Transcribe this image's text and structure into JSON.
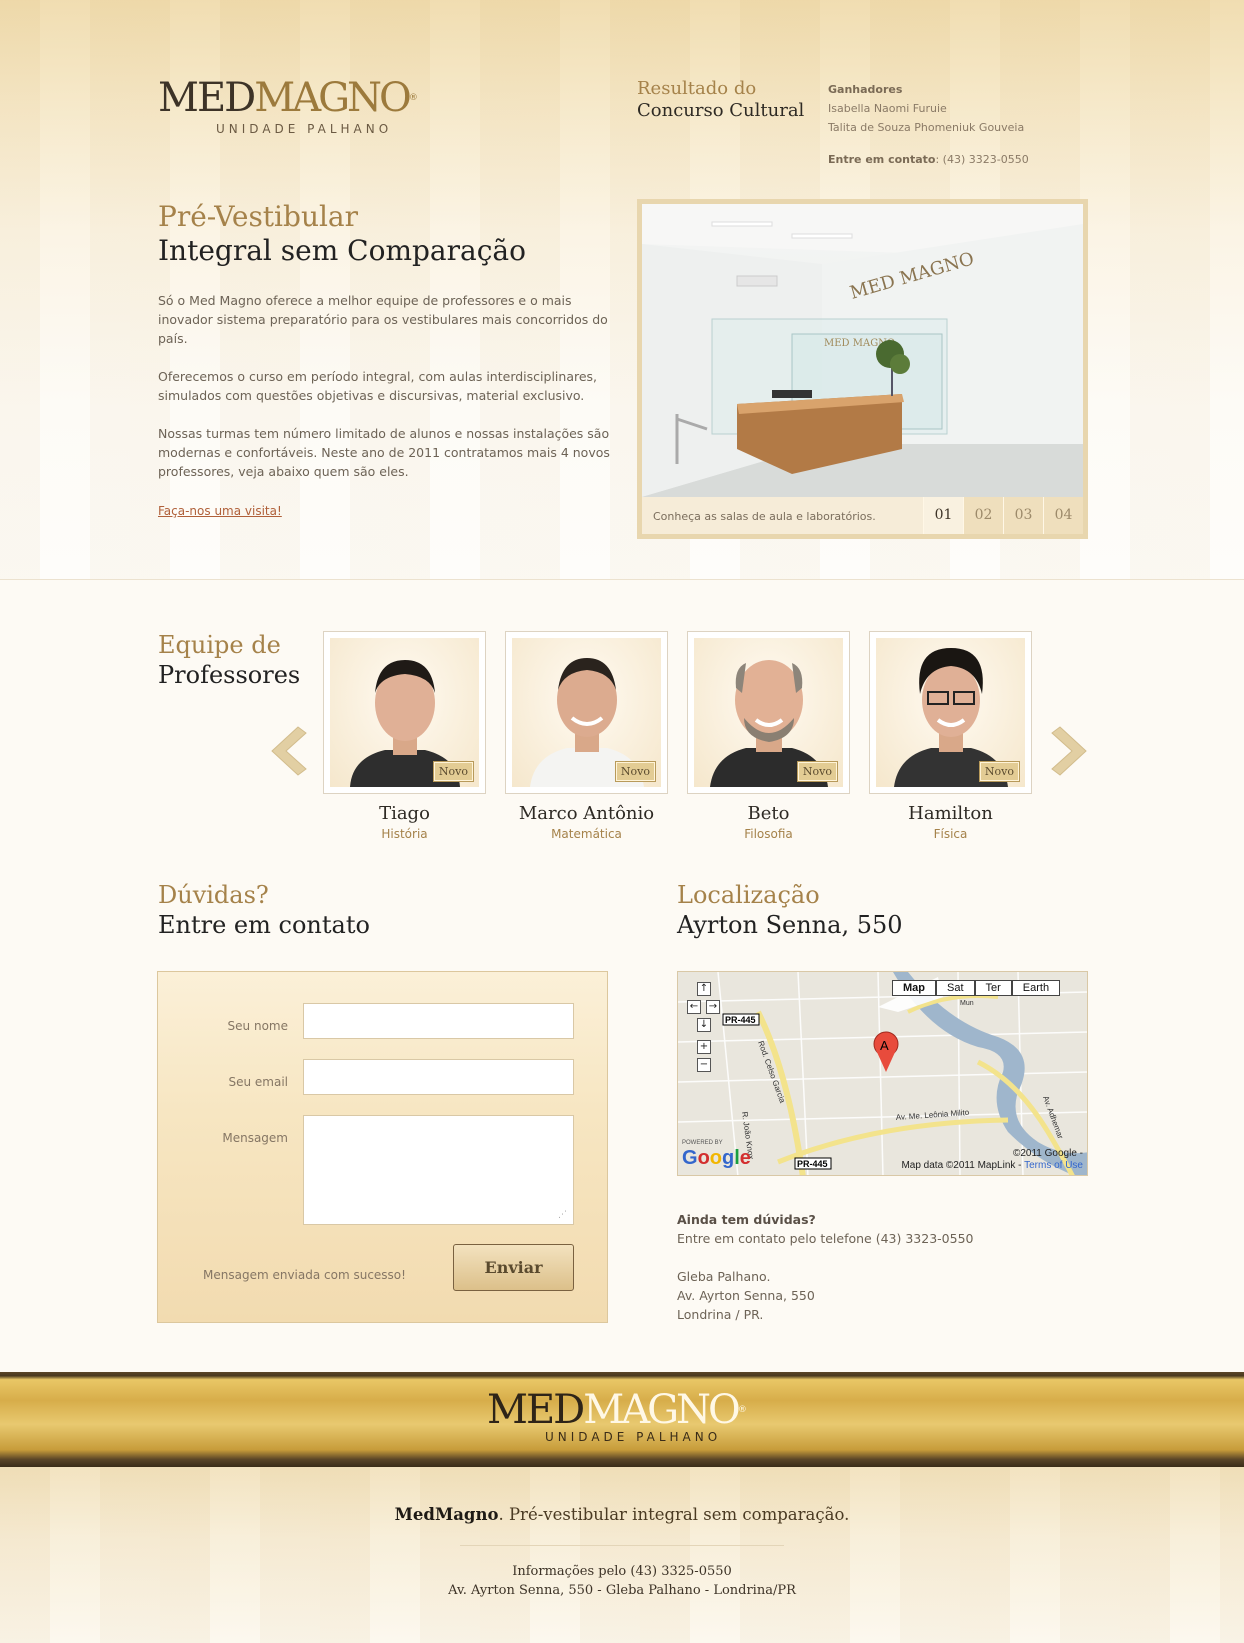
{
  "header": {
    "logo": {
      "med": "MED",
      "magno": "MAGNO",
      "reg": "®",
      "sub": "UNIDADE PALHANO"
    },
    "result": {
      "line1": "Resultado do",
      "line2": "Concurso Cultural"
    },
    "winners": {
      "heading": "Ganhadores",
      "names": [
        "Isabella Naomi Furuie",
        "Talita de Souza Phomeniuk Gouveia"
      ],
      "contact_label": "Entre em contato",
      "contact_phone": ": (43) 3323-0550"
    }
  },
  "intro": {
    "title_line1": "Pré-Vestibular",
    "title_line2": "Integral sem Comparação",
    "paragraphs": [
      "Só o Med Magno oferece a melhor equipe de professores e o mais inovador sistema preparatório para os vestibulares mais concorridos do país.",
      "Oferecemos o curso em período integral, com aulas interdisciplinares, simulados com questões objetivas e discursivas, material exclusivo.",
      "Nossas turmas tem número limitado de alunos e nossas instalações são modernas e confortáveis. Neste ano de 2011 contratamos mais 4 novos professores, veja abaixo quem são eles."
    ],
    "visit_link": "Faça-nos uma visita!"
  },
  "slideshow": {
    "wall_text": "MED MAGNO",
    "glass_text": "MED MAGNO",
    "caption": "Conheça as salas de aula e laboratórios.",
    "tabs": [
      "01",
      "02",
      "03",
      "04"
    ]
  },
  "professors": {
    "title_line1": "Equipe de",
    "title_line2": "Professores",
    "badge": "Novo",
    "items": [
      {
        "name": "Tiago",
        "subject": "História"
      },
      {
        "name": "Marco Antônio",
        "subject": "Matemática"
      },
      {
        "name": "Beto",
        "subject": "Filosofia"
      },
      {
        "name": "Hamilton",
        "subject": "Física"
      }
    ]
  },
  "contact": {
    "title_line1": "Dúvidas?",
    "title_line2": "Entre em contato",
    "name_label": "Seu nome",
    "email_label": "Seu email",
    "message_label": "Mensagem",
    "send_label": "Enviar",
    "status": "Mensagem enviada com sucesso!",
    "name_value": "",
    "email_value": "",
    "message_value": ""
  },
  "location": {
    "title_line1": "Localização",
    "title_line2": "Ayrton Senna, 550",
    "map": {
      "types": [
        "Map",
        "Sat",
        "Ter",
        "Earth"
      ],
      "marker": "A",
      "roads": [
        "PR-445",
        "Rod. Celso Garcia",
        "R. João Knox",
        "Av. Me. Leônia Milito",
        "PR-445",
        "Av. Adhemar",
        "Mun"
      ],
      "powered": "POWERED BY",
      "google": "Google",
      "copyright": "©2011 Google -",
      "mapdata": "Map data ©2011 MapLink - ",
      "terms": "Terms of Use"
    },
    "question": "Ainda tem dúvidas?",
    "phone_text": "Entre em contato pelo telefone (43) 3323-0550",
    "address_lines": [
      "Gleba Palhano.",
      "Av. Ayrton Senna, 550",
      "Londrina / PR."
    ]
  },
  "footer": {
    "logo": {
      "med": "MED",
      "magno": "MAGNO",
      "reg": "®",
      "sub": "UNIDADE PALHANO"
    },
    "tag_brand": "MedMagno",
    "tag_rest": ". Pré-vestibular integral sem comparação.",
    "info_line1": "Informações pelo (43) 3325-0550",
    "info_line2": "Av. Ayrton Senna, 550 - Gleba Palhano - Londrina/PR"
  }
}
